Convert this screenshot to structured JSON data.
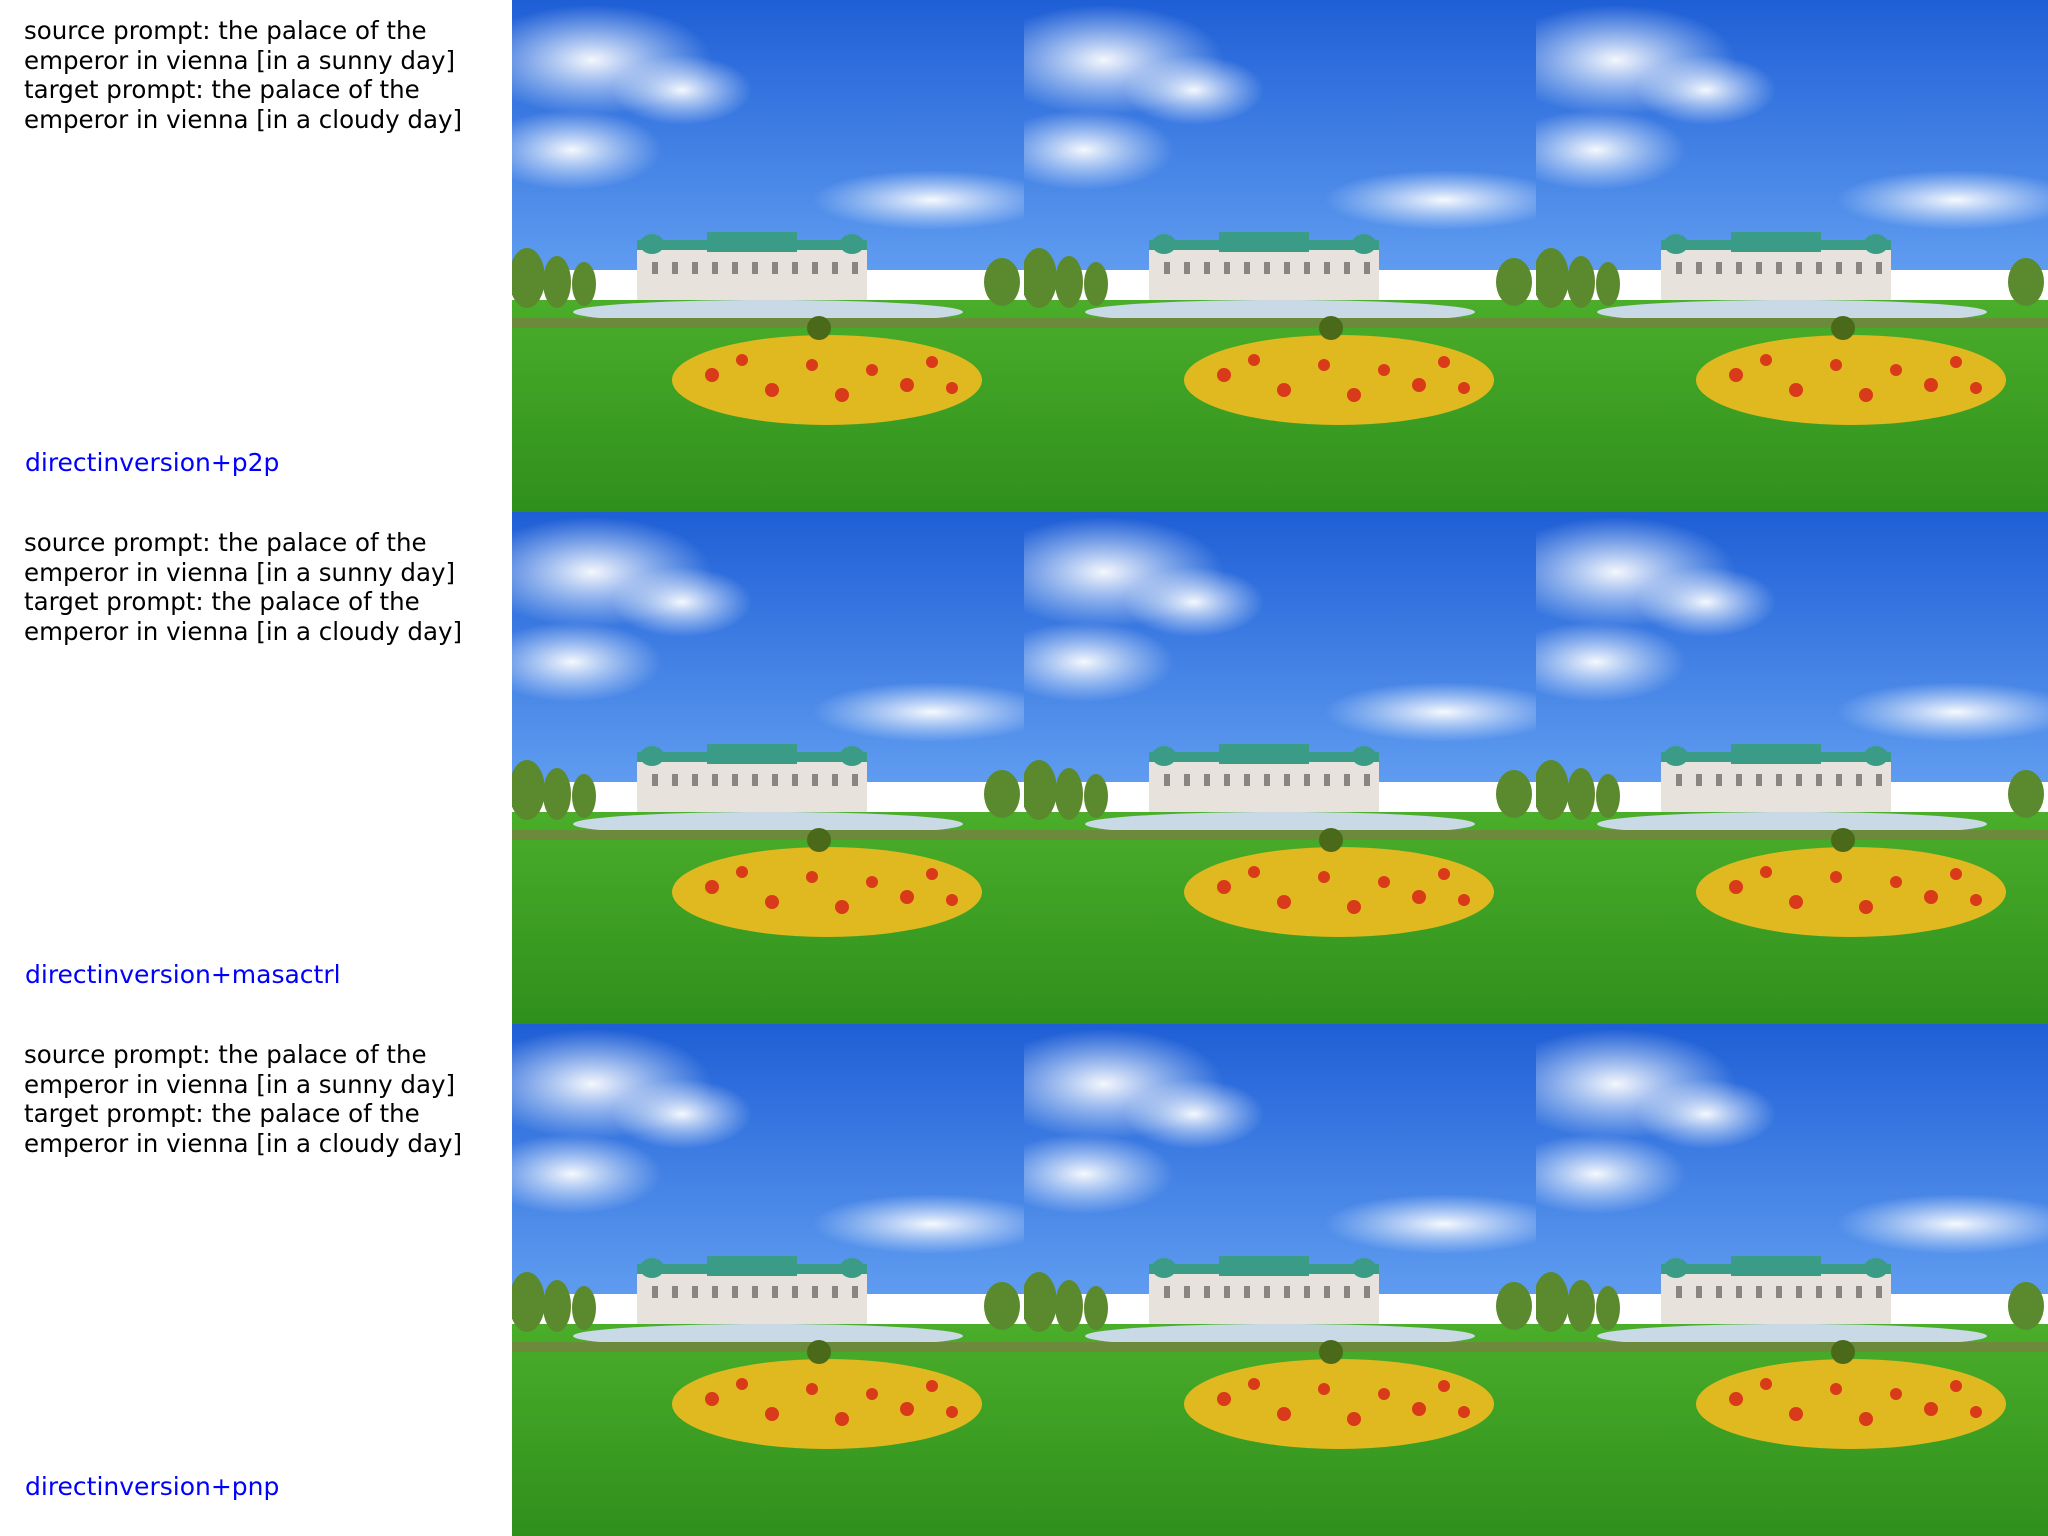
{
  "rows": [
    {
      "source_prompt": "source prompt: the palace of the\nemperor in vienna [in a sunny day]",
      "target_prompt": "target prompt: the palace of the\nemperor in vienna [in a cloudy day]",
      "method": "directinversion+p2p"
    },
    {
      "source_prompt": "source prompt: the palace of the\nemperor in vienna [in a sunny day]",
      "target_prompt": "target prompt: the palace of the\nemperor in vienna [in a cloudy day]",
      "method": "directinversion+masactrl"
    },
    {
      "source_prompt": "source prompt: the palace of the\nemperor in vienna [in a sunny day]",
      "target_prompt": "target prompt: the palace of the\nemperor in vienna [in a cloudy day]",
      "method": "directinversion+pnp"
    }
  ],
  "colors": {
    "method_label": "#0000ff",
    "sky": "#2f6fe0",
    "lawn": "#3fa626",
    "palace": "#e8e2dc",
    "roof": "#3a9c86"
  }
}
